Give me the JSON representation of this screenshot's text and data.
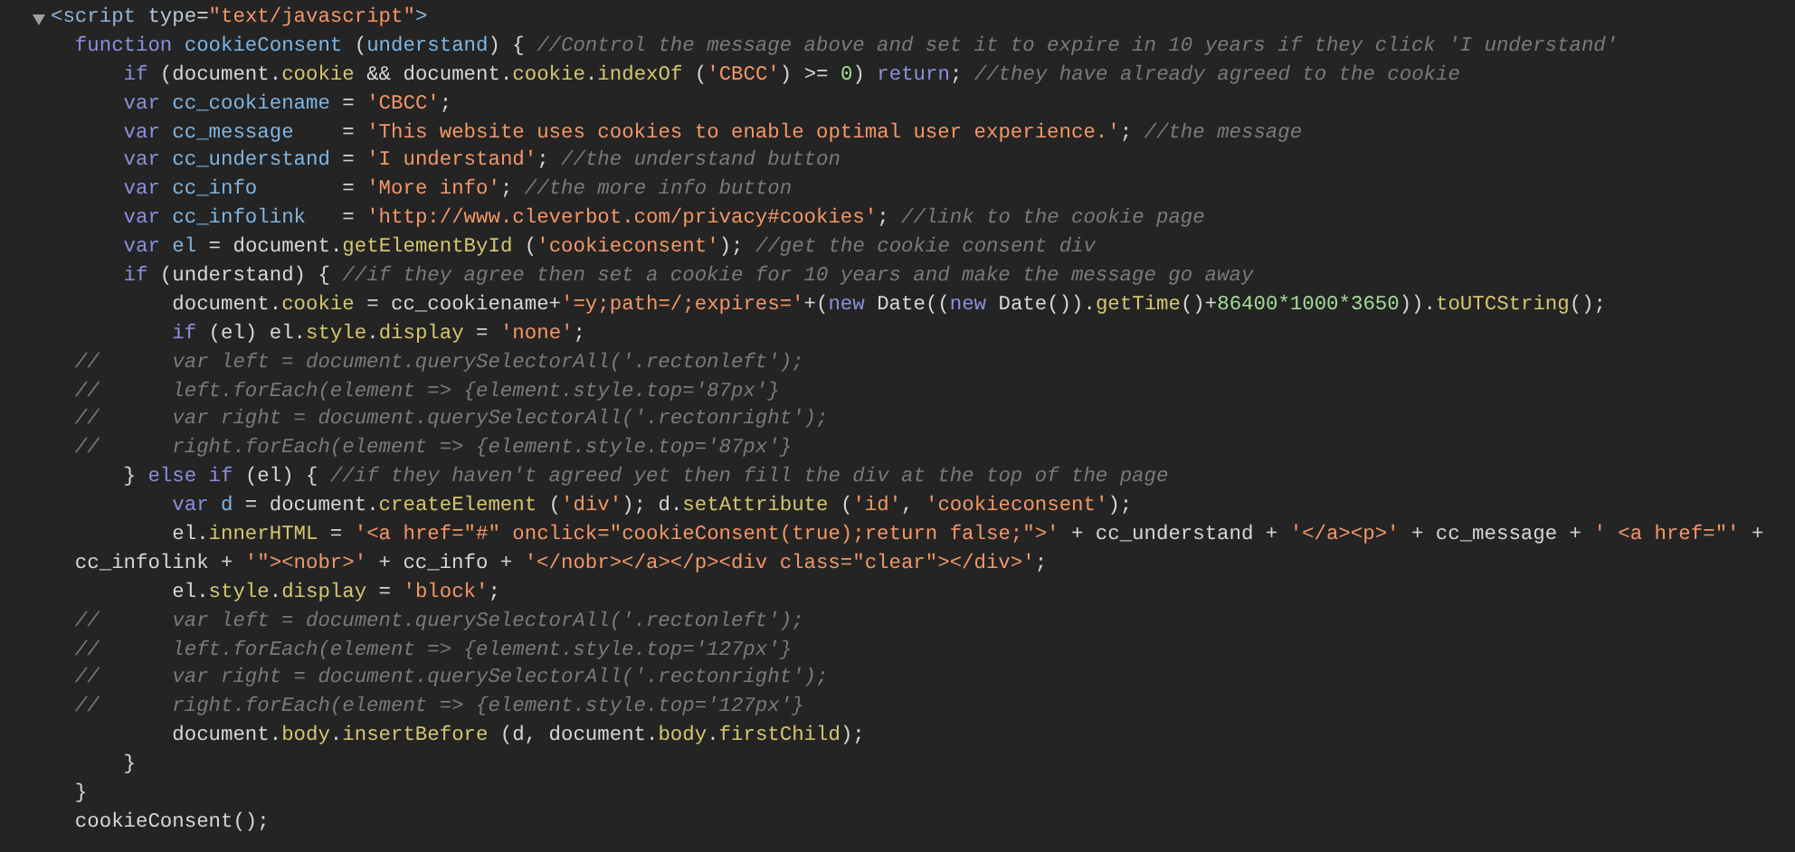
{
  "script_element": {
    "expanded": true
  },
  "lines": [
    {
      "tokens": [
        {
          "kind": "tag",
          "text": "<script"
        },
        {
          "kind": "attr",
          "text": " type"
        },
        {
          "kind": "plain",
          "text": "="
        },
        {
          "kind": "string",
          "text": "\"text/javascript\""
        },
        {
          "kind": "tag",
          "text": ">"
        }
      ]
    },
    {
      "tokens": [
        {
          "kind": "keyword",
          "text": "  function"
        },
        {
          "kind": "def",
          "text": " cookieConsent"
        },
        {
          "kind": "plain",
          "text": " ("
        },
        {
          "kind": "def",
          "text": "understand"
        },
        {
          "kind": "plain",
          "text": ") { "
        },
        {
          "kind": "comment",
          "text": "//Control the message above and set it to expire in 10 years if they click 'I understand'"
        }
      ]
    },
    {
      "tokens": [
        {
          "kind": "keyword",
          "text": "      if"
        },
        {
          "kind": "plain",
          "text": " (document."
        },
        {
          "kind": "prop",
          "text": "cookie"
        },
        {
          "kind": "plain",
          "text": " && document."
        },
        {
          "kind": "prop",
          "text": "cookie"
        },
        {
          "kind": "plain",
          "text": "."
        },
        {
          "kind": "prop",
          "text": "indexOf"
        },
        {
          "kind": "plain",
          "text": " ("
        },
        {
          "kind": "string",
          "text": "'CBCC'"
        },
        {
          "kind": "plain",
          "text": ") >= "
        },
        {
          "kind": "number",
          "text": "0"
        },
        {
          "kind": "plain",
          "text": ") "
        },
        {
          "kind": "keyword",
          "text": "return"
        },
        {
          "kind": "plain",
          "text": "; "
        },
        {
          "kind": "comment",
          "text": "//they have already agreed to the cookie"
        }
      ]
    },
    {
      "tokens": [
        {
          "kind": "keyword",
          "text": "      var"
        },
        {
          "kind": "def",
          "text": " cc_cookiename"
        },
        {
          "kind": "plain",
          "text": " = "
        },
        {
          "kind": "string",
          "text": "'CBCC'"
        },
        {
          "kind": "plain",
          "text": ";"
        }
      ]
    },
    {
      "tokens": [
        {
          "kind": "keyword",
          "text": "      var"
        },
        {
          "kind": "def",
          "text": " cc_message"
        },
        {
          "kind": "plain",
          "text": "    = "
        },
        {
          "kind": "string",
          "text": "'This website uses cookies to enable optimal user experience.'"
        },
        {
          "kind": "plain",
          "text": "; "
        },
        {
          "kind": "comment",
          "text": "//the message"
        }
      ]
    },
    {
      "tokens": [
        {
          "kind": "keyword",
          "text": "      var"
        },
        {
          "kind": "def",
          "text": " cc_understand"
        },
        {
          "kind": "plain",
          "text": " = "
        },
        {
          "kind": "string",
          "text": "'I understand'"
        },
        {
          "kind": "plain",
          "text": "; "
        },
        {
          "kind": "comment",
          "text": "//the understand button"
        }
      ]
    },
    {
      "tokens": [
        {
          "kind": "keyword",
          "text": "      var"
        },
        {
          "kind": "def",
          "text": " cc_info"
        },
        {
          "kind": "plain",
          "text": "       = "
        },
        {
          "kind": "string",
          "text": "'More info'"
        },
        {
          "kind": "plain",
          "text": "; "
        },
        {
          "kind": "comment",
          "text": "//the more info button"
        }
      ]
    },
    {
      "tokens": [
        {
          "kind": "keyword",
          "text": "      var"
        },
        {
          "kind": "def",
          "text": " cc_infolink"
        },
        {
          "kind": "plain",
          "text": "   = "
        },
        {
          "kind": "string",
          "text": "'http://www.cleverbot.com/privacy#cookies'"
        },
        {
          "kind": "plain",
          "text": "; "
        },
        {
          "kind": "comment",
          "text": "//link to the cookie page"
        }
      ]
    },
    {
      "tokens": [
        {
          "kind": "keyword",
          "text": "      var"
        },
        {
          "kind": "def",
          "text": " el"
        },
        {
          "kind": "plain",
          "text": " = document."
        },
        {
          "kind": "prop",
          "text": "getElementById"
        },
        {
          "kind": "plain",
          "text": " ("
        },
        {
          "kind": "string",
          "text": "'cookieconsent'"
        },
        {
          "kind": "plain",
          "text": "); "
        },
        {
          "kind": "comment",
          "text": "//get the cookie consent div"
        }
      ]
    },
    {
      "tokens": [
        {
          "kind": "keyword",
          "text": "      if"
        },
        {
          "kind": "plain",
          "text": " (understand) { "
        },
        {
          "kind": "comment",
          "text": "//if they agree then set a cookie for 10 years and make the message go away"
        }
      ]
    },
    {
      "tokens": [
        {
          "kind": "plain",
          "text": "          document."
        },
        {
          "kind": "prop",
          "text": "cookie"
        },
        {
          "kind": "plain",
          "text": " = cc_cookiename+"
        },
        {
          "kind": "string",
          "text": "'=y;path=/;expires='"
        },
        {
          "kind": "plain",
          "text": "+("
        },
        {
          "kind": "keyword",
          "text": "new"
        },
        {
          "kind": "plain",
          "text": " Date(("
        },
        {
          "kind": "keyword",
          "text": "new"
        },
        {
          "kind": "plain",
          "text": " Date())."
        },
        {
          "kind": "prop",
          "text": "getTime"
        },
        {
          "kind": "plain",
          "text": "()+"
        },
        {
          "kind": "number",
          "text": "86400*1000*3650"
        },
        {
          "kind": "plain",
          "text": "))."
        },
        {
          "kind": "prop",
          "text": "toUTCString"
        },
        {
          "kind": "plain",
          "text": "();"
        }
      ]
    },
    {
      "tokens": [
        {
          "kind": "keyword",
          "text": "          if"
        },
        {
          "kind": "plain",
          "text": " (el) el."
        },
        {
          "kind": "prop",
          "text": "style"
        },
        {
          "kind": "plain",
          "text": "."
        },
        {
          "kind": "prop",
          "text": "display"
        },
        {
          "kind": "plain",
          "text": " = "
        },
        {
          "kind": "string",
          "text": "'none'"
        },
        {
          "kind": "plain",
          "text": ";"
        }
      ]
    },
    {
      "tokens": [
        {
          "kind": "comment",
          "text": "  //      var left = document.querySelectorAll('.rectonleft');"
        }
      ]
    },
    {
      "tokens": [
        {
          "kind": "comment",
          "text": "  //      left.forEach(element => {element.style.top='87px'}"
        }
      ]
    },
    {
      "tokens": [
        {
          "kind": "comment",
          "text": "  //      var right = document.querySelectorAll('.rectonright');"
        }
      ]
    },
    {
      "tokens": [
        {
          "kind": "comment",
          "text": "  //      right.forEach(element => {element.style.top='87px'}"
        }
      ]
    },
    {
      "tokens": [
        {
          "kind": "plain",
          "text": "      } "
        },
        {
          "kind": "keyword",
          "text": "else"
        },
        {
          "kind": "keyword",
          "text": " if"
        },
        {
          "kind": "plain",
          "text": " (el) { "
        },
        {
          "kind": "comment",
          "text": "//if they haven't agreed yet then fill the div at the top of the page"
        }
      ]
    },
    {
      "tokens": [
        {
          "kind": "keyword",
          "text": "          var"
        },
        {
          "kind": "def",
          "text": " d"
        },
        {
          "kind": "plain",
          "text": " = document."
        },
        {
          "kind": "prop",
          "text": "createElement"
        },
        {
          "kind": "plain",
          "text": " ("
        },
        {
          "kind": "string",
          "text": "'div'"
        },
        {
          "kind": "plain",
          "text": "); d."
        },
        {
          "kind": "prop",
          "text": "setAttribute"
        },
        {
          "kind": "plain",
          "text": " ("
        },
        {
          "kind": "string",
          "text": "'id'"
        },
        {
          "kind": "plain",
          "text": ", "
        },
        {
          "kind": "string",
          "text": "'cookieconsent'"
        },
        {
          "kind": "plain",
          "text": ");"
        }
      ]
    },
    {
      "tokens": [
        {
          "kind": "plain",
          "text": "          el."
        },
        {
          "kind": "prop",
          "text": "innerHTML"
        },
        {
          "kind": "plain",
          "text": " = "
        },
        {
          "kind": "string",
          "text": "'<a href=\"#\" onclick=\"cookieConsent(true);return false;\">'"
        },
        {
          "kind": "plain",
          "text": " + cc_understand + "
        },
        {
          "kind": "string",
          "text": "'</a><p>'"
        },
        {
          "kind": "plain",
          "text": " + cc_message + "
        },
        {
          "kind": "string",
          "text": "' <a href=\"'"
        },
        {
          "kind": "plain",
          "text": " +"
        }
      ]
    },
    {
      "tokens": [
        {
          "kind": "plain",
          "text": "  cc_infolink + "
        },
        {
          "kind": "string",
          "text": "'\"><nobr>'"
        },
        {
          "kind": "plain",
          "text": " + cc_info + "
        },
        {
          "kind": "string",
          "text": "'</nobr></a></p><div class=\"clear\"></div>'"
        },
        {
          "kind": "plain",
          "text": ";"
        }
      ]
    },
    {
      "tokens": [
        {
          "kind": "plain",
          "text": "          el."
        },
        {
          "kind": "prop",
          "text": "style"
        },
        {
          "kind": "plain",
          "text": "."
        },
        {
          "kind": "prop",
          "text": "display"
        },
        {
          "kind": "plain",
          "text": " = "
        },
        {
          "kind": "string",
          "text": "'block'"
        },
        {
          "kind": "plain",
          "text": ";"
        }
      ]
    },
    {
      "tokens": [
        {
          "kind": "comment",
          "text": "  //      var left = document.querySelectorAll('.rectonleft');"
        }
      ]
    },
    {
      "tokens": [
        {
          "kind": "comment",
          "text": "  //      left.forEach(element => {element.style.top='127px'}"
        }
      ]
    },
    {
      "tokens": [
        {
          "kind": "comment",
          "text": "  //      var right = document.querySelectorAll('.rectonright');"
        }
      ]
    },
    {
      "tokens": [
        {
          "kind": "comment",
          "text": "  //      right.forEach(element => {element.style.top='127px'}"
        }
      ]
    },
    {
      "tokens": [
        {
          "kind": "plain",
          "text": "          document."
        },
        {
          "kind": "prop",
          "text": "body"
        },
        {
          "kind": "plain",
          "text": "."
        },
        {
          "kind": "prop",
          "text": "insertBefore"
        },
        {
          "kind": "plain",
          "text": " (d, document."
        },
        {
          "kind": "prop",
          "text": "body"
        },
        {
          "kind": "plain",
          "text": "."
        },
        {
          "kind": "prop",
          "text": "firstChild"
        },
        {
          "kind": "plain",
          "text": ");"
        }
      ]
    },
    {
      "tokens": [
        {
          "kind": "plain",
          "text": "      }"
        }
      ]
    },
    {
      "tokens": [
        {
          "kind": "plain",
          "text": "  }"
        }
      ]
    },
    {
      "tokens": [
        {
          "kind": "plain",
          "text": "  cookieConsent();"
        }
      ]
    }
  ]
}
